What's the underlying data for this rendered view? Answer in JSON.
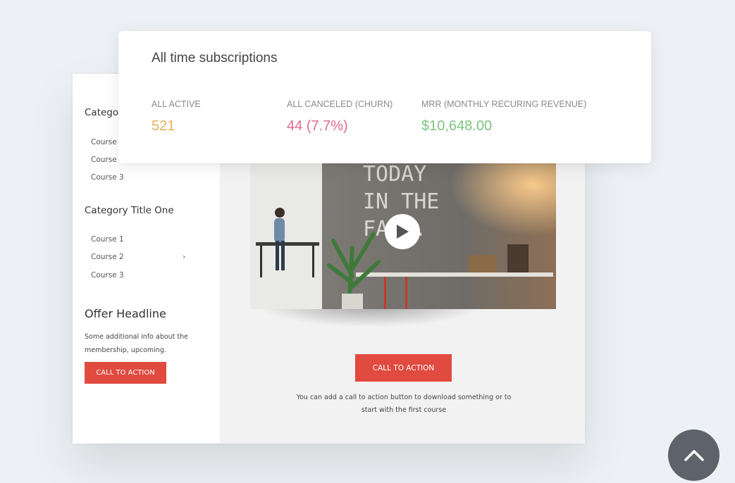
{
  "stats": {
    "title": "All time subscriptions",
    "items": [
      {
        "label": "ALL ACTIVE",
        "value": "521",
        "color": "#e8b05a"
      },
      {
        "label": "ALL CANCELED (CHURN)",
        "value": "44 (7.7%)",
        "color": "#e46a8d"
      },
      {
        "label": "MRR (MONTHLY RECURING REVENUE)",
        "value": "$10,648.00",
        "color": "#7cc47f"
      }
    ]
  },
  "sidebar": {
    "categories": [
      {
        "title": "Categor",
        "items": [
          "Course 1",
          "Course 2",
          "Course 3"
        ]
      },
      {
        "title": "Category Title One",
        "items": [
          "Course 1",
          "Course 2",
          "Course 3"
        ]
      }
    ],
    "offer": {
      "headline": "Offer Headline",
      "text": "Some additional info about the membership, upcoming.",
      "button": "CALL TO ACTION"
    }
  },
  "main": {
    "video": {
      "overlay_text": [
        "TODAY",
        "IN THE",
        "FACE."
      ],
      "play_icon": "play-icon"
    },
    "button": "CALL TO ACTION",
    "text": "You can add a call to action button to download something or to start with the first course"
  },
  "colors": {
    "accent_red": "#e04a3f",
    "scroll_button": "#5e636b"
  },
  "icons": {
    "scroll_top": "chevron-up-icon",
    "course_arrow": "chevron-right-icon"
  }
}
